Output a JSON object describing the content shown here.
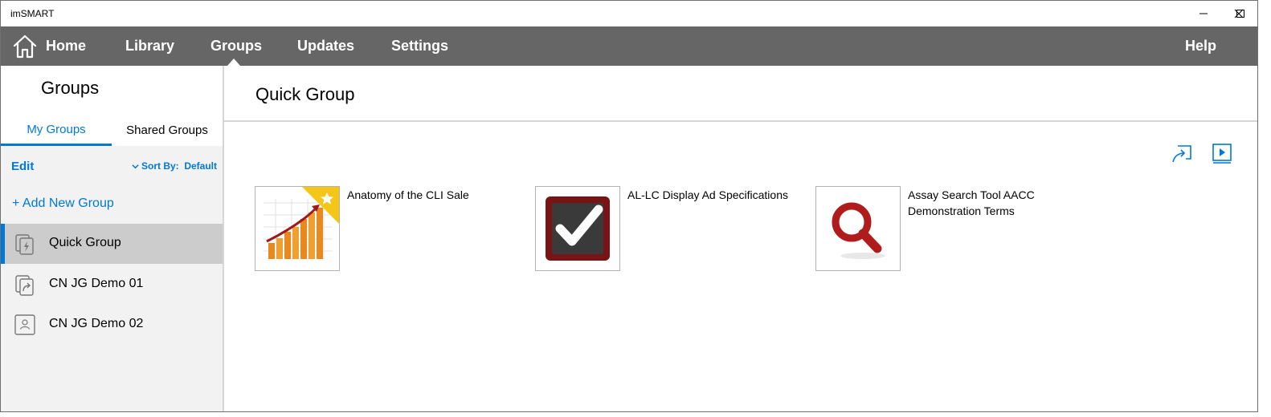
{
  "window": {
    "title": "imSMART"
  },
  "nav": {
    "home": "Home",
    "library": "Library",
    "groups": "Groups",
    "updates": "Updates",
    "settings": "Settings",
    "help": "Help",
    "active": "Groups"
  },
  "sidebar": {
    "title": "Groups",
    "tabs": [
      {
        "label": "My Groups",
        "active": true
      },
      {
        "label": "Shared Groups",
        "active": false
      }
    ],
    "edit_label": "Edit",
    "sort_prefix": "Sort By:",
    "sort_value": "Default",
    "add_group_label": "+ Add New Group",
    "groups": [
      {
        "label": "Quick Group",
        "icon": "quick-group-icon",
        "selected": true
      },
      {
        "label": "CN JG Demo 01",
        "icon": "shared-docs-icon",
        "selected": false
      },
      {
        "label": "CN JG Demo 02",
        "icon": "person-icon",
        "selected": false
      }
    ]
  },
  "main": {
    "title": "Quick Group",
    "toolbar": {
      "share_icon": "present-share-icon",
      "play_icon": "play-icon"
    },
    "documents": [
      {
        "title": "Anatomy of the CLI Sale",
        "thumb": "growth-chart-thumbnail",
        "favorite": true
      },
      {
        "title": "AL-LC Display Ad Specifications",
        "thumb": "checkmark-thumbnail",
        "favorite": false
      },
      {
        "title": "Assay Search Tool AACC Demonstration Terms",
        "thumb": "magnifier-thumbnail",
        "favorite": false
      }
    ]
  },
  "colors": {
    "accent": "#0078d7",
    "navbar": "#666666",
    "sidebar_bg": "#f2f2f2",
    "selected_bg": "#cccccc",
    "favorite_corner": "#f5c518"
  }
}
